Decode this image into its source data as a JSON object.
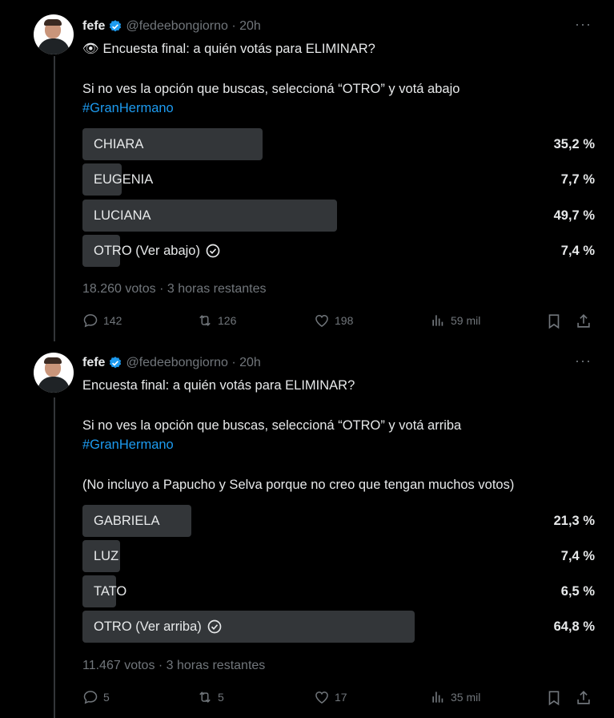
{
  "tweets": [
    {
      "author": "fefe",
      "handle": "@fedeebongiorno · 20h",
      "line1_emoji": "👁",
      "line1": "Encuesta final: a quién votás para ELIMINAR?",
      "line2": "Si no ves la opción que buscas, seleccioná “OTRO” y votá abajo",
      "hashtag": "#GranHermano",
      "poll": [
        {
          "label": "CHIARA",
          "percent_text": "35,2 %",
          "fraction": 0.352,
          "checked": false
        },
        {
          "label": "EUGENIA",
          "percent_text": "7,7 %",
          "fraction": 0.077,
          "checked": false
        },
        {
          "label": "LUCIANA",
          "percent_text": "49,7 %",
          "fraction": 0.497,
          "checked": false
        },
        {
          "label": "OTRO (Ver abajo)",
          "percent_text": "7,4 %",
          "fraction": 0.074,
          "checked": true
        }
      ],
      "votes": "18.260 votos · 3 horas restantes",
      "replies": "142",
      "reposts": "126",
      "likes": "198",
      "views": "59 mil"
    },
    {
      "author": "fefe",
      "handle": "@fedeebongiorno · 20h",
      "line1": "Encuesta final: a quién votás para ELIMINAR?",
      "line2": "Si no ves la opción que buscas, seleccioná “OTRO” y votá arriba",
      "hashtag": "#GranHermano",
      "line3": "(No incluyo a Papucho y Selva porque no creo que tengan muchos votos)",
      "poll": [
        {
          "label": "GABRIELA",
          "percent_text": "21,3 %",
          "fraction": 0.213,
          "checked": false
        },
        {
          "label": "LUZ",
          "percent_text": "7,4 %",
          "fraction": 0.074,
          "checked": false
        },
        {
          "label": "TATO",
          "percent_text": "6,5 %",
          "fraction": 0.065,
          "checked": false
        },
        {
          "label": "OTRO (Ver arriba)",
          "percent_text": "64,8 %",
          "fraction": 0.648,
          "checked": true
        }
      ],
      "votes": "11.467 votos · 3 horas restantes",
      "replies": "5",
      "reposts": "5",
      "likes": "17",
      "views": "35 mil"
    }
  ],
  "icons": {
    "verified": "verified-badge-icon",
    "more": "more-icon",
    "reply": "reply-icon",
    "repost": "repost-icon",
    "like": "heart-icon",
    "views": "views-icon",
    "bookmark": "bookmark-icon",
    "share": "share-icon",
    "check": "check-circle-icon"
  },
  "colors": {
    "background": "#000000",
    "text": "#e7e9ea",
    "muted": "#71767b",
    "accent": "#1d9bf0",
    "poll_bar": "#333639"
  }
}
